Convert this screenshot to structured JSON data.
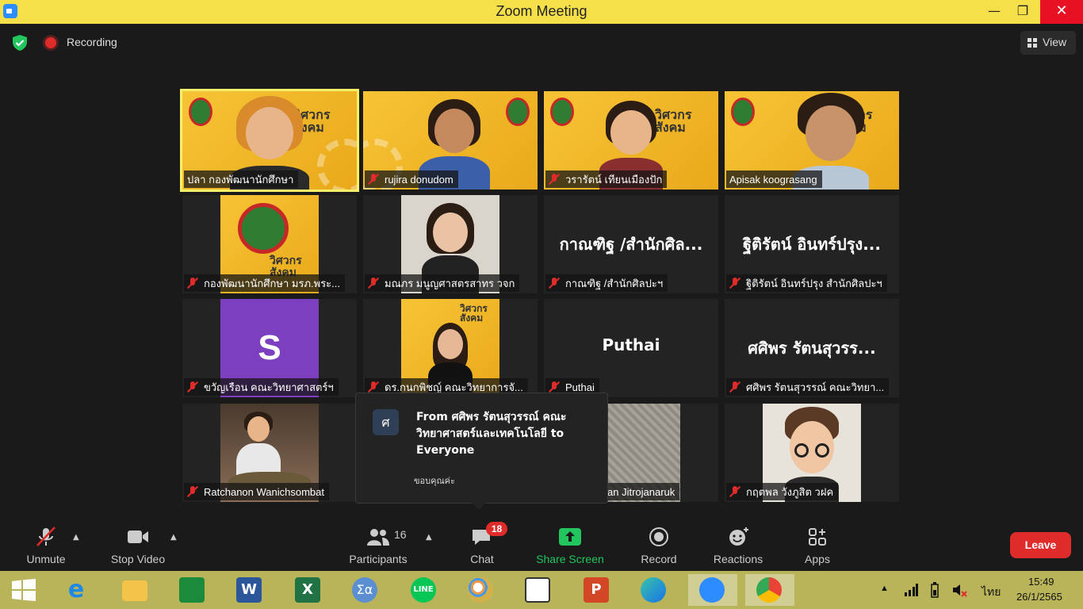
{
  "window": {
    "title": "Zoom Meeting",
    "minimize": "—",
    "maximize": "❐",
    "close": "✕"
  },
  "topbar": {
    "recording_label": "Recording",
    "view_label": "View"
  },
  "tiles": [
    {
      "name": "ปลา กองพัฒนานักศึกษา",
      "muted": false,
      "brand": "วิศวกร สังคม"
    },
    {
      "name": "rujira donudom",
      "muted": true,
      "brand": "วิศวกร สังคม"
    },
    {
      "name": "วรารัตน์ เทียนเมืองปัก",
      "muted": true,
      "brand": "วิศวกร สังคม"
    },
    {
      "name": "Apisak koograsang",
      "muted": false,
      "brand": "วิศวกร สังคม"
    },
    {
      "name": "กองพัฒนานักศึกษา มรภ.พระ...",
      "muted": true,
      "brand": "วิศวกร สังคม"
    },
    {
      "name": "มณภร มนูญศาสตรสาทร วจก",
      "muted": true
    },
    {
      "name": "กาณฑิฐ /สำนักศิลปะฯ",
      "muted": true,
      "display": "กาณฑิฐ /สำนักศิล..."
    },
    {
      "name": "ฐิติรัตน์ อินทร์ปรุง สำนักศิลปะฯ",
      "muted": true,
      "display": "ฐิติรัตน์ อินทร์ปรุง..."
    },
    {
      "name": "ขวัญเรือน คณะวิทยาศาสตร์ฯ",
      "muted": true,
      "avatar_letter": "S"
    },
    {
      "name": "ดร.กนกพิชญ์ คณะวิทยาการจั...",
      "muted": true,
      "brand": "วิศวกร สังคม"
    },
    {
      "name": "Puthai",
      "muted": true,
      "display": "Puthai"
    },
    {
      "name": "ศศิพร รัตนสุวรรณ์ คณะวิทยา...",
      "muted": true,
      "display": "ศศิพร รัตนสุวรร..."
    },
    {
      "name": "Ratchanon Wanichsombat",
      "muted": true
    },
    {
      "name": "an Jitrojanaruk",
      "muted": false
    },
    {
      "name": "กฤตพล วังภูสิต วฝค",
      "muted": true
    }
  ],
  "chat_popup": {
    "avatar": "ศ",
    "from": "From ศศิพร รัตนสุวรรณ์ คณะวิทยาศาสตร์และเทคโนโลยี to Everyone",
    "message": "ขอบคุณค่ะ"
  },
  "toolbar": {
    "unmute": "Unmute",
    "stop_video": "Stop Video",
    "participants": "Participants",
    "participants_count": "16",
    "chat": "Chat",
    "chat_badge": "18",
    "share_screen": "Share Screen",
    "record": "Record",
    "reactions": "Reactions",
    "apps": "Apps",
    "leave": "Leave"
  },
  "taskbar": {
    "language": "ไทย",
    "time": "15:49",
    "date": "26/1/2565",
    "apps": [
      "start-icon",
      "internet-explorer-icon",
      "file-explorer-icon",
      "store-icon",
      "word-icon",
      "excel-icon",
      "calculator-icon",
      "line-icon",
      "paint-icon",
      "lisrel-icon",
      "powerpoint-icon",
      "edge-icon",
      "zoom-icon",
      "chrome-icon"
    ]
  },
  "colors": {
    "accent_green": "#22c55e",
    "leave_red": "#e02b2b",
    "titlebar": "#f5e04a",
    "taskbar": "#b9b45a"
  }
}
